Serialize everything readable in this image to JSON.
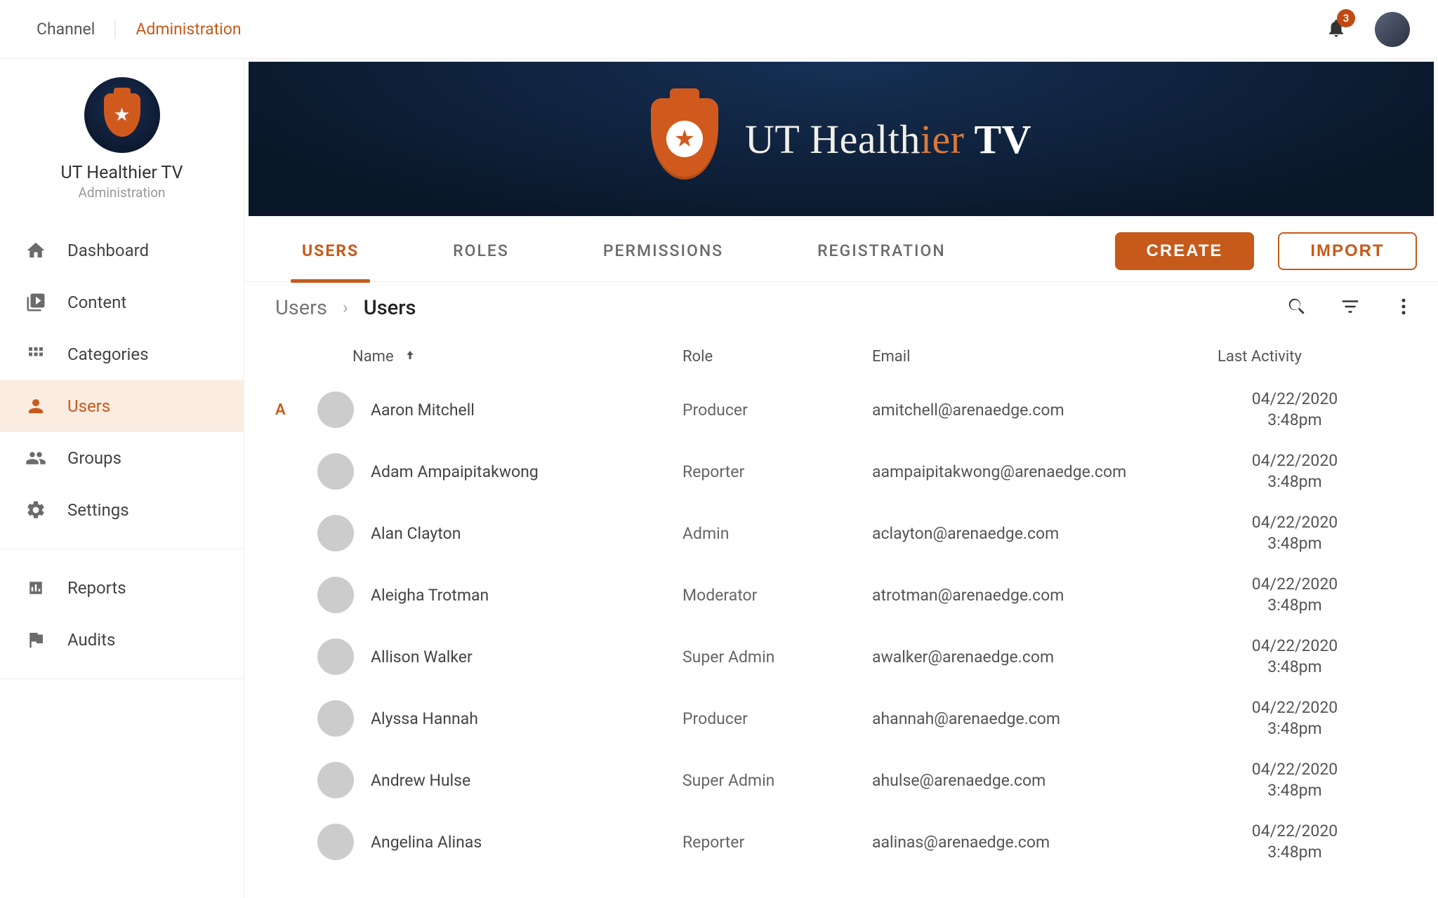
{
  "topbar": {
    "crumbs": [
      "Channel",
      "Administration"
    ],
    "notifications": "3"
  },
  "sidebar": {
    "brand_title": "UT Healthier TV",
    "brand_sub": "Administration",
    "nav1": [
      {
        "label": "Dashboard",
        "icon": "home"
      },
      {
        "label": "Content",
        "icon": "video"
      },
      {
        "label": "Categories",
        "icon": "grid"
      },
      {
        "label": "Users",
        "icon": "user",
        "active": true
      },
      {
        "label": "Groups",
        "icon": "group"
      },
      {
        "label": "Settings",
        "icon": "gear"
      }
    ],
    "nav2": [
      {
        "label": "Reports",
        "icon": "bar"
      },
      {
        "label": "Audits",
        "icon": "flag"
      }
    ]
  },
  "banner": {
    "title_pre": "UT Health",
    "title_accent": "ier",
    "title_post": " TV"
  },
  "tabs": [
    {
      "label": "USERS",
      "active": true
    },
    {
      "label": "ROLES"
    },
    {
      "label": "PERMISSIONS"
    },
    {
      "label": "REGISTRATION"
    }
  ],
  "buttons": {
    "create": "CREATE",
    "import": "IMPORT"
  },
  "breadcrumb": [
    "Users",
    "Users"
  ],
  "columns": {
    "name": "Name",
    "role": "Role",
    "email": "Email",
    "last": "Last Activity"
  },
  "section_letter": "A",
  "rows": [
    {
      "name": "Aaron Mitchell",
      "role": "Producer",
      "email": "amitchell@arenaedge.com",
      "date": "04/22/2020",
      "time": "3:48pm",
      "c": "c1"
    },
    {
      "name": "Adam Ampaipitakwong",
      "role": "Reporter",
      "email": "aampaipitakwong@arenaedge.com",
      "date": "04/22/2020",
      "time": "3:48pm",
      "c": "c2"
    },
    {
      "name": "Alan Clayton",
      "role": "Admin",
      "email": "aclayton@arenaedge.com",
      "date": "04/22/2020",
      "time": "3:48pm",
      "c": "c3"
    },
    {
      "name": "Aleigha Trotman",
      "role": "Moderator",
      "email": "atrotman@arenaedge.com",
      "date": "04/22/2020",
      "time": "3:48pm",
      "c": "c4"
    },
    {
      "name": "Allison Walker",
      "role": "Super Admin",
      "email": "awalker@arenaedge.com",
      "date": "04/22/2020",
      "time": "3:48pm",
      "c": "c5"
    },
    {
      "name": "Alyssa Hannah",
      "role": "Producer",
      "email": "ahannah@arenaedge.com",
      "date": "04/22/2020",
      "time": "3:48pm",
      "c": "c6"
    },
    {
      "name": "Andrew Hulse",
      "role": "Super Admin",
      "email": "ahulse@arenaedge.com",
      "date": "04/22/2020",
      "time": "3:48pm",
      "c": "c7"
    },
    {
      "name": "Angelina Alinas",
      "role": "Reporter",
      "email": "aalinas@arenaedge.com",
      "date": "04/22/2020",
      "time": "3:48pm",
      "c": "c8"
    }
  ]
}
